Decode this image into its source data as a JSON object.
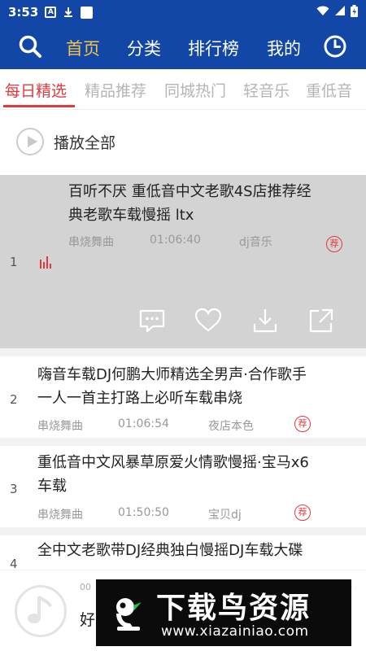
{
  "status_bar": {
    "time": "3:53"
  },
  "top_nav": {
    "items": [
      {
        "label": "首页",
        "active": true
      },
      {
        "label": "分类",
        "active": false
      },
      {
        "label": "排行榜",
        "active": false
      },
      {
        "label": "我的",
        "active": false
      }
    ],
    "accent_color": "#f6c445",
    "bar_color": "#1247a8"
  },
  "tabs": {
    "items": [
      "每日精选",
      "精品推荐",
      "同城热门",
      "轻音乐",
      "重低音"
    ],
    "active_index": 0,
    "active_color": "#e0393e"
  },
  "play_all": {
    "label": "播放全部"
  },
  "songs": [
    {
      "index": "1",
      "title_line1": "百听不厌 重低音中文老歌4S店推荐经",
      "title_line2": "典老歌车载慢摇 ltx",
      "genre": "串烧舞曲",
      "duration": "01:06:40",
      "uploader": "dj音乐",
      "badge": "荐",
      "playing": true
    },
    {
      "index": "2",
      "title_line1": "嗨音车载DJ何鹏大师精选全男声·合作歌手",
      "title_line2": "一人一首主打路上必听车载串烧",
      "genre": "串烧舞曲",
      "duration": "01:06:54",
      "uploader": "夜店本色",
      "badge": "荐",
      "playing": false
    },
    {
      "index": "3",
      "title_line1": "重低音中文风暴草原爱火情歌慢摇·宝马x6",
      "title_line2": "车载",
      "genre": "串烧舞曲",
      "duration": "01:50:50",
      "uploader": "宝贝dj",
      "badge": "荐",
      "playing": false
    },
    {
      "index": "4",
      "title_line1": "全中文老歌带DJ经典独白慢摇DJ车载大碟",
      "title_line2": "",
      "genre": "",
      "duration": "",
      "uploader": "",
      "badge": "",
      "playing": false
    }
  ],
  "player": {
    "time_start": "00",
    "time_end": "0",
    "title_partial": "好"
  },
  "watermark": {
    "big_text": "下载鸟资源",
    "url": "www.xiazainiao.com"
  }
}
